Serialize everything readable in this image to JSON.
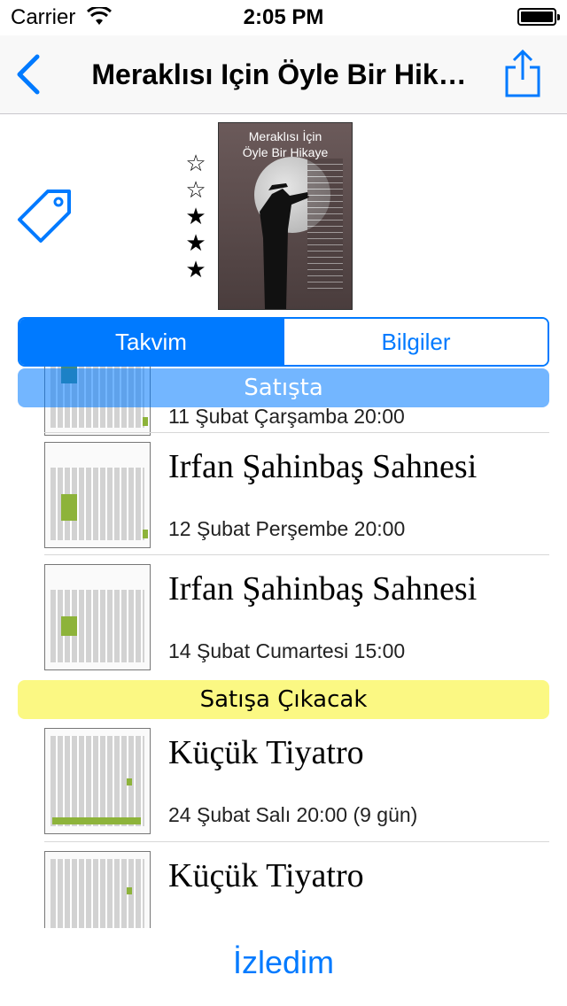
{
  "status_bar": {
    "carrier": "Carrier",
    "time": "2:05 PM"
  },
  "nav": {
    "title": "Meraklısı Için Öyle Bir Hik…",
    "back_icon": "chevron-left-icon",
    "share_icon": "share-icon"
  },
  "header": {
    "rating": {
      "filled": 3,
      "max": 5
    },
    "stars": [
      "☆",
      "☆",
      "★",
      "★",
      "★"
    ],
    "poster_title": "Meraklısı İçin\nÖyle Bir Hikaye"
  },
  "segments": {
    "active": "Takvim",
    "inactive": "Bilgiler"
  },
  "sections": {
    "on_sale": "Satışta",
    "coming_soon": "Satışa Çıkacak"
  },
  "events_on_sale": [
    {
      "date": "11 Şubat Çarşamba 20:00"
    },
    {
      "venue": "Irfan Şahinbaş Sahnesi",
      "date": "12 Şubat Perşembe 20:00"
    },
    {
      "venue": "Irfan Şahinbaş Sahnesi",
      "date": "14 Şubat Cumartesi 15:00"
    }
  ],
  "events_coming": [
    {
      "venue": "Küçük Tiyatro",
      "date": "24 Şubat Salı 20:00 (9 gün)"
    },
    {
      "venue": "Küçük Tiyatro"
    }
  ],
  "bottom_button": "İzledim",
  "colors": {
    "accent": "#007aff",
    "on_sale_header": "#7fb6fb",
    "coming_header": "#fbf883",
    "seat_available": "#8db33a"
  }
}
